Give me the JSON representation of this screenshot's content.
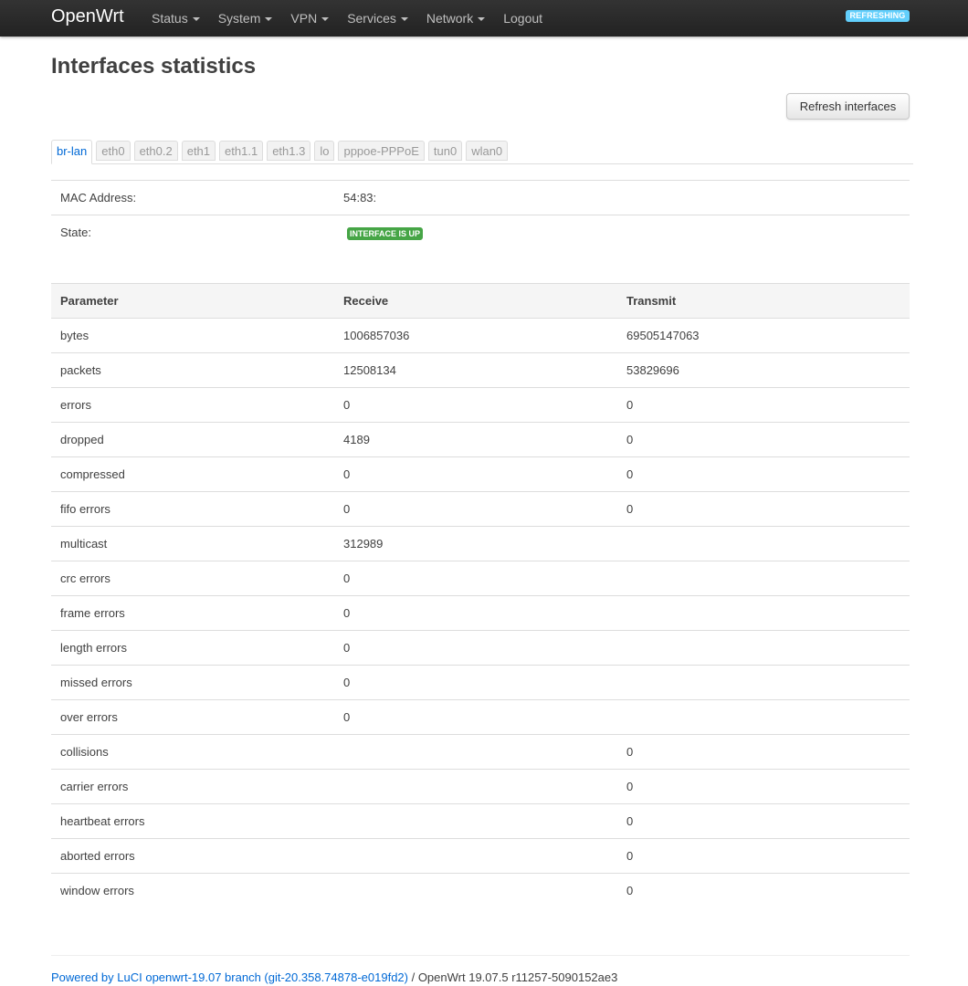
{
  "nav": {
    "brand": "OpenWrt",
    "items": [
      {
        "label": "Status",
        "dropdown": true
      },
      {
        "label": "System",
        "dropdown": true
      },
      {
        "label": "VPN",
        "dropdown": true
      },
      {
        "label": "Services",
        "dropdown": true
      },
      {
        "label": "Network",
        "dropdown": true
      },
      {
        "label": "Logout",
        "dropdown": false
      }
    ],
    "status_badge": "REFRESHING"
  },
  "page": {
    "title": "Interfaces statistics",
    "refresh_button": "Refresh interfaces"
  },
  "tabs": [
    "br-lan",
    "eth0",
    "eth0.2",
    "eth1",
    "eth1.1",
    "eth1.3",
    "lo",
    "pppoe-PPPoE",
    "tun0",
    "wlan0"
  ],
  "active_tab": "br-lan",
  "info": {
    "mac_label": "MAC Address:",
    "mac_value": "54:83:",
    "state_label": "State:",
    "state_value": "INTERFACE IS UP"
  },
  "stats": {
    "headers": [
      "Parameter",
      "Receive",
      "Transmit"
    ],
    "rows": [
      [
        "bytes",
        "1006857036",
        "69505147063"
      ],
      [
        "packets",
        "12508134",
        "53829696"
      ],
      [
        "errors",
        "0",
        "0"
      ],
      [
        "dropped",
        "4189",
        "0"
      ],
      [
        "compressed",
        "0",
        "0"
      ],
      [
        "fifo errors",
        "0",
        "0"
      ],
      [
        "multicast",
        "312989",
        ""
      ],
      [
        "crc errors",
        "0",
        ""
      ],
      [
        "frame errors",
        "0",
        ""
      ],
      [
        "length errors",
        "0",
        ""
      ],
      [
        "missed errors",
        "0",
        ""
      ],
      [
        "over errors",
        "0",
        ""
      ],
      [
        "collisions",
        "",
        "0"
      ],
      [
        "carrier errors",
        "",
        "0"
      ],
      [
        "heartbeat errors",
        "",
        "0"
      ],
      [
        "aborted errors",
        "",
        "0"
      ],
      [
        "window errors",
        "",
        "0"
      ]
    ]
  },
  "footer": {
    "link_text": "Powered by LuCI openwrt-19.07 branch (git-20.358.74878-e019fd2)",
    "suffix": " / OpenWrt 19.07.5 r11257-5090152ae3"
  },
  "colors": {
    "accent": "#0069d6",
    "navbar": "#222222",
    "badge_refreshing": "#62cffc",
    "badge_up": "#46a546"
  }
}
